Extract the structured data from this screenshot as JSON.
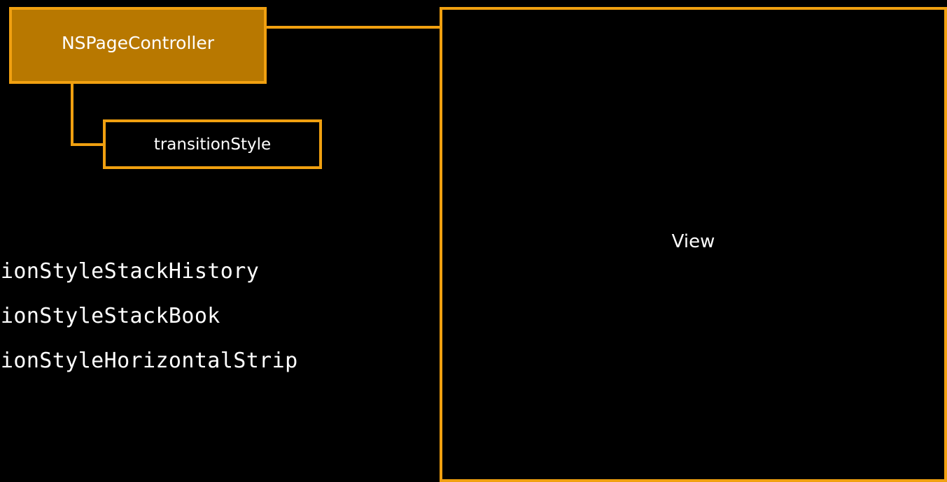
{
  "diagram": {
    "controller": {
      "label": "NSPageController"
    },
    "property": {
      "label": "transitionStyle"
    },
    "view": {
      "label": "View"
    },
    "transition_styles": [
      "itionStyleStackHistory",
      "itionStyleStackBook",
      "itionStyleHorizontalStrip"
    ],
    "colors": {
      "background": "#000000",
      "accent_border": "#F0A010",
      "controller_fill": "#B87800",
      "text": "#FFFFFF"
    }
  }
}
